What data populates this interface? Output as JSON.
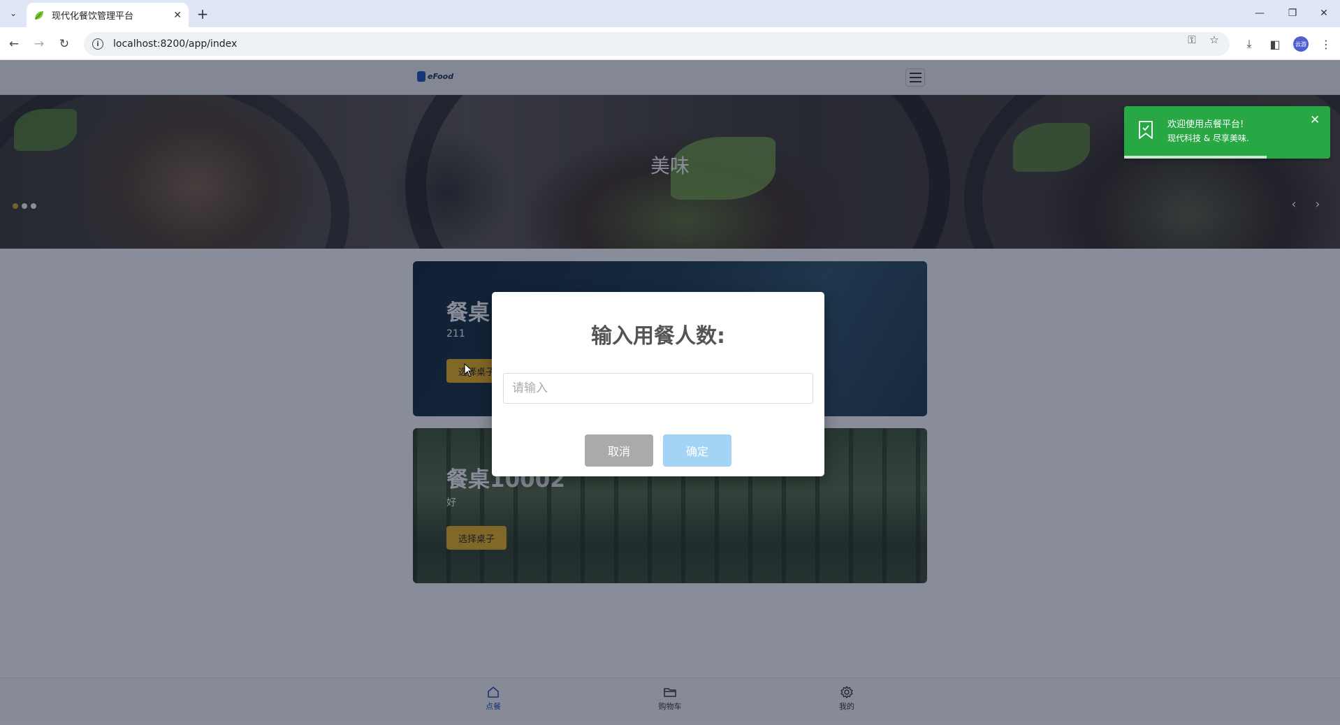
{
  "browser": {
    "tab_title": "现代化餐饮管理平台",
    "url": "localhost:8200/app/index",
    "profile_label": "云游"
  },
  "site": {
    "logo_text": "eFood"
  },
  "banner": {
    "title": "美味",
    "active_slide": 1,
    "slide_count": 3
  },
  "tables": [
    {
      "name": "餐桌",
      "description": "211",
      "button": "选择桌子"
    },
    {
      "name": "餐桌10002",
      "description": "好",
      "button": "选择桌子"
    }
  ],
  "bottom_nav": [
    {
      "label": "点餐",
      "icon": "home-icon",
      "active": true
    },
    {
      "label": "购物车",
      "icon": "folder-icon",
      "active": false
    },
    {
      "label": "我的",
      "icon": "gear-icon",
      "active": false
    }
  ],
  "toast": {
    "title": "欢迎使用点餐平台!",
    "message": "现代科技 & 尽享美味.",
    "color": "#28a745",
    "progress": 0.69
  },
  "dialog": {
    "title": "输入用餐人数:",
    "input_placeholder": "请输入",
    "input_value": "",
    "cancel_label": "取消",
    "confirm_label": "确定"
  },
  "colors": {
    "accent": "#1d4fb8",
    "card_button": "#f0b418",
    "confirm_button": "#a3d4f5",
    "cancel_button": "#aaaaaa"
  }
}
